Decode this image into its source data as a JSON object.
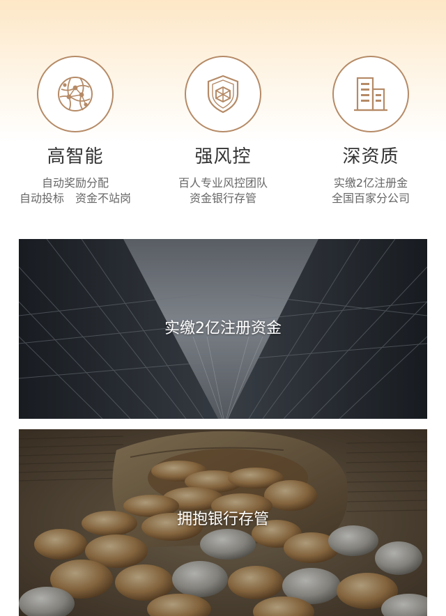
{
  "features": [
    {
      "icon": "globe-network-icon",
      "title": "高智能",
      "desc_line1": "自动奖励分配",
      "desc_line2": "自动投标　资金不站岗"
    },
    {
      "icon": "shield-icon",
      "title": "强风控",
      "desc_line1": "百人专业风控团队",
      "desc_line2": "资金银行存管"
    },
    {
      "icon": "building-icon",
      "title": "深资质",
      "desc_line1": "实缴2亿注册金",
      "desc_line2": "全国百家分公司"
    }
  ],
  "banners": [
    {
      "caption": "实缴2亿注册资金",
      "image": "skyscraper-photo"
    },
    {
      "caption": "拥抱银行存管",
      "image": "coins-on-newspaper-photo"
    }
  ],
  "colors": {
    "accent": "#b58a66",
    "title": "#333333",
    "desc": "#666666",
    "top_gradient": "#fde7c6"
  }
}
